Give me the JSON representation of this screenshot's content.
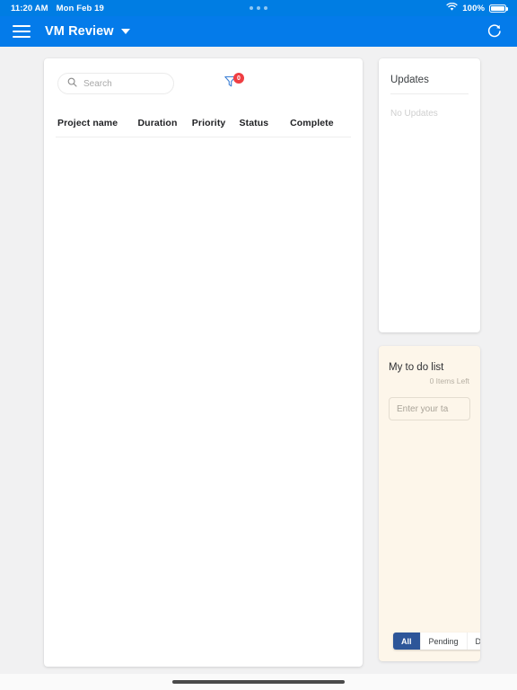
{
  "statusbar": {
    "time": "11:20 AM",
    "date": "Mon Feb 19",
    "battery_percent": "100%",
    "wifi_icon": "wifi-icon",
    "battery_icon": "battery-full-icon",
    "dots_icon": "three-dots-icon"
  },
  "appbar": {
    "menu_icon": "hamburger-menu-icon",
    "title": "VM Review",
    "dropdown_icon": "chevron-down-icon",
    "refresh_icon": "refresh-icon",
    "background_color": "#047bea"
  },
  "projects": {
    "search": {
      "placeholder": "Search",
      "value": "",
      "icon": "search-icon"
    },
    "filter": {
      "icon": "filter-funnel-icon",
      "badge_count": "0"
    },
    "columns": [
      {
        "label": "Project name"
      },
      {
        "label": "Duration"
      },
      {
        "label": "Priority"
      },
      {
        "label": "Status"
      },
      {
        "label": "Complete"
      }
    ],
    "rows": []
  },
  "updates": {
    "title": "Updates",
    "empty_text": "No Updates",
    "items": []
  },
  "todo": {
    "title": "My to do list",
    "items_left": "0 Items Left",
    "input_placeholder": "Enter your ta",
    "input_value": "",
    "background_color": "#fdf6ea",
    "filters": [
      {
        "label": "All",
        "active": true
      },
      {
        "label": "Pending",
        "active": false
      },
      {
        "label": "D",
        "active": false
      }
    ],
    "items": []
  },
  "colors": {
    "accent": "#047bea",
    "status_bar": "#007de3",
    "badge": "#ef3e42",
    "active_filter": "#2d5699",
    "page_background": "#f1f1f2"
  }
}
